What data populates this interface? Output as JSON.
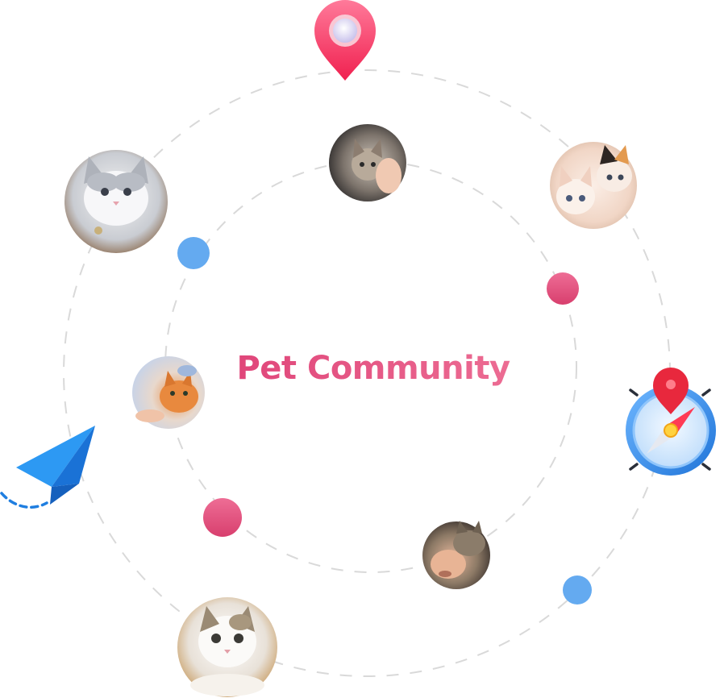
{
  "title": "Pet Community",
  "colors": {
    "title_start": "#e0467a",
    "title_end": "#ec6c93",
    "orbit_dash": "#d6d6d6",
    "dot_blue": "#64aaf0",
    "dot_pink": "#e14f7c",
    "pin_pink": "#ff4b7a",
    "plane_blue": "#1f8ef1",
    "compass_blue": "#3d95ee"
  },
  "icons": {
    "top_pin": "location-pin-icon",
    "plane": "paper-plane-icon",
    "compass": "compass-icon"
  },
  "avatars": [
    {
      "name": "avatar-gray-kitten",
      "subject": "gray-white-kitten"
    },
    {
      "name": "avatar-hand-kitten",
      "subject": "tabby-kitten-in-hand"
    },
    {
      "name": "avatar-two-kittens",
      "subject": "two-kittens"
    },
    {
      "name": "avatar-orange-cat",
      "subject": "orange-cat-being-petted"
    },
    {
      "name": "avatar-man-with-cat",
      "subject": "man-with-cat"
    },
    {
      "name": "avatar-white-cat",
      "subject": "white-calico-cat"
    }
  ]
}
